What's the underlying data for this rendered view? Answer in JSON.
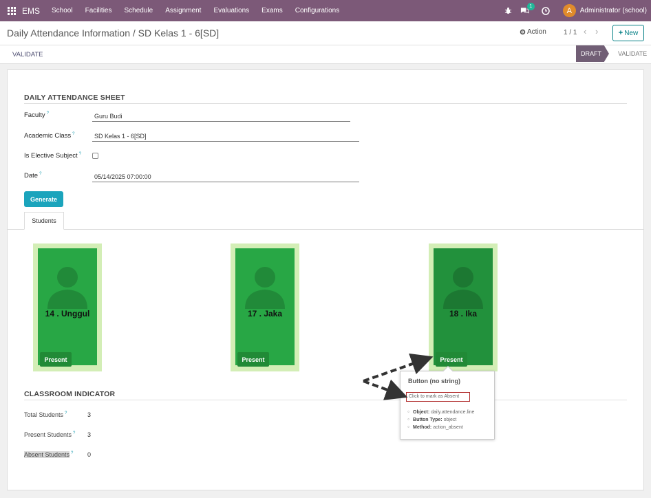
{
  "navbar": {
    "brand": "EMS",
    "menu": [
      "School",
      "Facilities",
      "Schedule",
      "Assignment",
      "Evaluations",
      "Exams",
      "Configurations"
    ],
    "chat_badge": "1",
    "user_initial": "A",
    "user_name": "Administrator (school)",
    "color": "#7c5978"
  },
  "control": {
    "breadcrumb": "Daily Attendance Information / SD Kelas 1 - 6[SD]",
    "action_label": "Action",
    "pager": "1 / 1",
    "new_label": "New"
  },
  "statusbar": {
    "validate_button": "VALIDATE",
    "stages": {
      "active": "DRAFT",
      "next": "VALIDATE"
    }
  },
  "form": {
    "section_title": "DAILY ATTENDANCE SHEET",
    "help_mark": "?",
    "fields": {
      "faculty": {
        "label": "Faculty",
        "value": "Guru Budi"
      },
      "academic_class": {
        "label": "Academic Class",
        "value": "SD Kelas 1 - 6[SD]"
      },
      "is_elective": {
        "label": "Is Elective Subject",
        "checked": false
      },
      "date": {
        "label": "Date",
        "value": "05/14/2025 07:00:00"
      }
    },
    "generate_button": "Generate",
    "tab_students": "Students"
  },
  "students": [
    {
      "name": "14 . Unggul",
      "status": "Present"
    },
    {
      "name": "17 . Jaka",
      "status": "Present"
    },
    {
      "name": "18 . Ika",
      "status": "Present"
    }
  ],
  "indicator": {
    "section_title": "CLASSROOM INDICATOR",
    "total_label": "Total Students",
    "total_value": "3",
    "present_label": "Present Students",
    "present_value": "3",
    "absent_label": "Absent Students",
    "absent_value": "0"
  },
  "tooltip": {
    "title": "Button (no string)",
    "help": "Click to mark as Absent",
    "object_label": "Object:",
    "object_value": "daily.attendance.line",
    "type_label": "Button Type:",
    "type_value": "object",
    "method_label": "Method:",
    "method_value": "action_absent"
  },
  "icons": [
    "apps-icon",
    "bug-icon",
    "chat-icon",
    "clock-icon",
    "gear-icon",
    "chevron-left-icon",
    "chevron-right-icon",
    "plus-icon",
    "person-icon"
  ]
}
